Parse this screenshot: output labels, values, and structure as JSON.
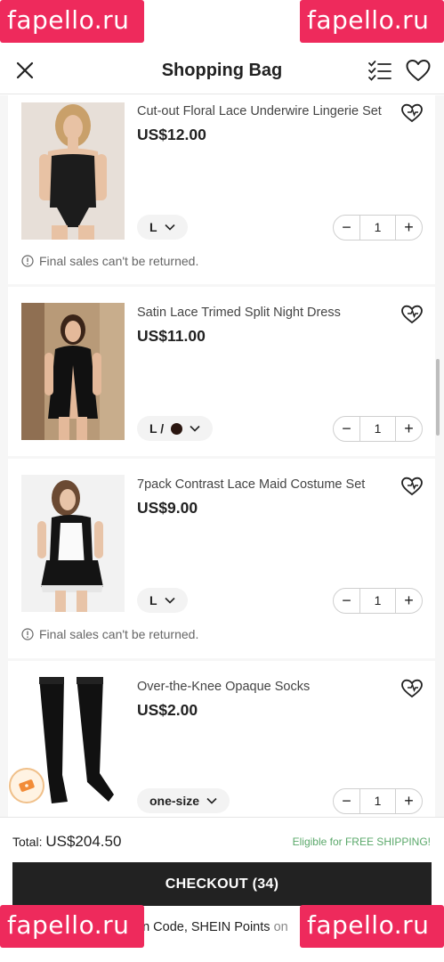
{
  "watermark": "fapello.ru",
  "header": {
    "title": "Shopping Bag"
  },
  "items": [
    {
      "name": "Cut-out Floral Lace Underwire Lingerie Set",
      "price": "US$12.00",
      "size": "L",
      "quantity": "1",
      "notice": "Final sales can't be returned."
    },
    {
      "name": "Satin Lace Trimed Split Night Dress",
      "price": "US$11.00",
      "size": "L /",
      "quantity": "1"
    },
    {
      "name": "7pack Contrast Lace Maid Costume Set",
      "price": "US$9.00",
      "size": "L",
      "quantity": "1",
      "notice": "Final sales can't be returned."
    },
    {
      "name": "Over-the-Knee Opaque Socks",
      "price": "US$2.00",
      "size": "one-size",
      "quantity": "1"
    }
  ],
  "footer": {
    "total_label": "Total:",
    "total_amount": "US$204.50",
    "shipping": "Eligible for FREE SHIPPING!",
    "checkout_label": "CHECKOUT (34)",
    "promo_text": "on Code, SHEIN Points",
    "promo_suffix": "on"
  },
  "colors": {
    "brand_watermark": "#ee2a5c",
    "checkout_bg": "#222222",
    "shipping_green": "#5aa86a",
    "dress_swatch": "#2a1610"
  }
}
